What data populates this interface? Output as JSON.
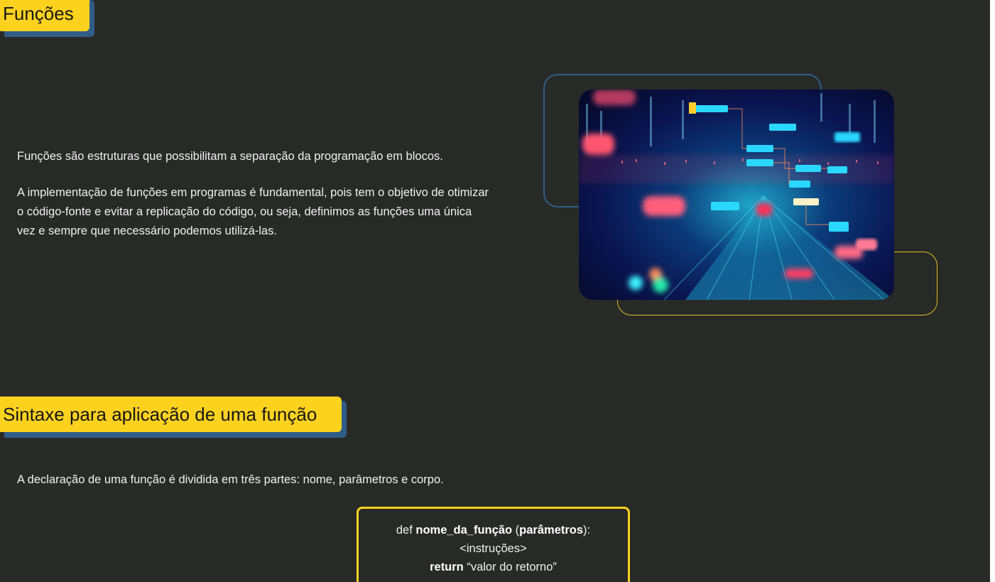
{
  "section1": {
    "title": "Funções",
    "paragraph1": "Funções são estruturas que possibilitam a separação da programação em blocos.",
    "paragraph2": "A implementação de funções em programas é fundamental, pois tem o objetivo de otimizar o código-fonte e evitar a replicação do código, ou seja, definimos as funções uma única vez e sempre que necessário podemos utilizá-las."
  },
  "section2": {
    "title": "Sintaxe para aplicação de uma função",
    "paragraph": "A declaração de uma função é dividida em três partes: nome, parâmetros e corpo."
  },
  "code": {
    "line1_kw": "def ",
    "line1_name": "nome_da_função",
    "line1_open": " (",
    "line1_params": "parâmetros",
    "line1_close": "):",
    "line2": "<instruções>",
    "line3_kw": "return",
    "line3_rest": " “valor do retorno”"
  },
  "colors": {
    "background": "#282a28",
    "accent_yellow": "#fdd21f",
    "accent_blue": "#2f5d88",
    "text": "#f0f0f0"
  }
}
